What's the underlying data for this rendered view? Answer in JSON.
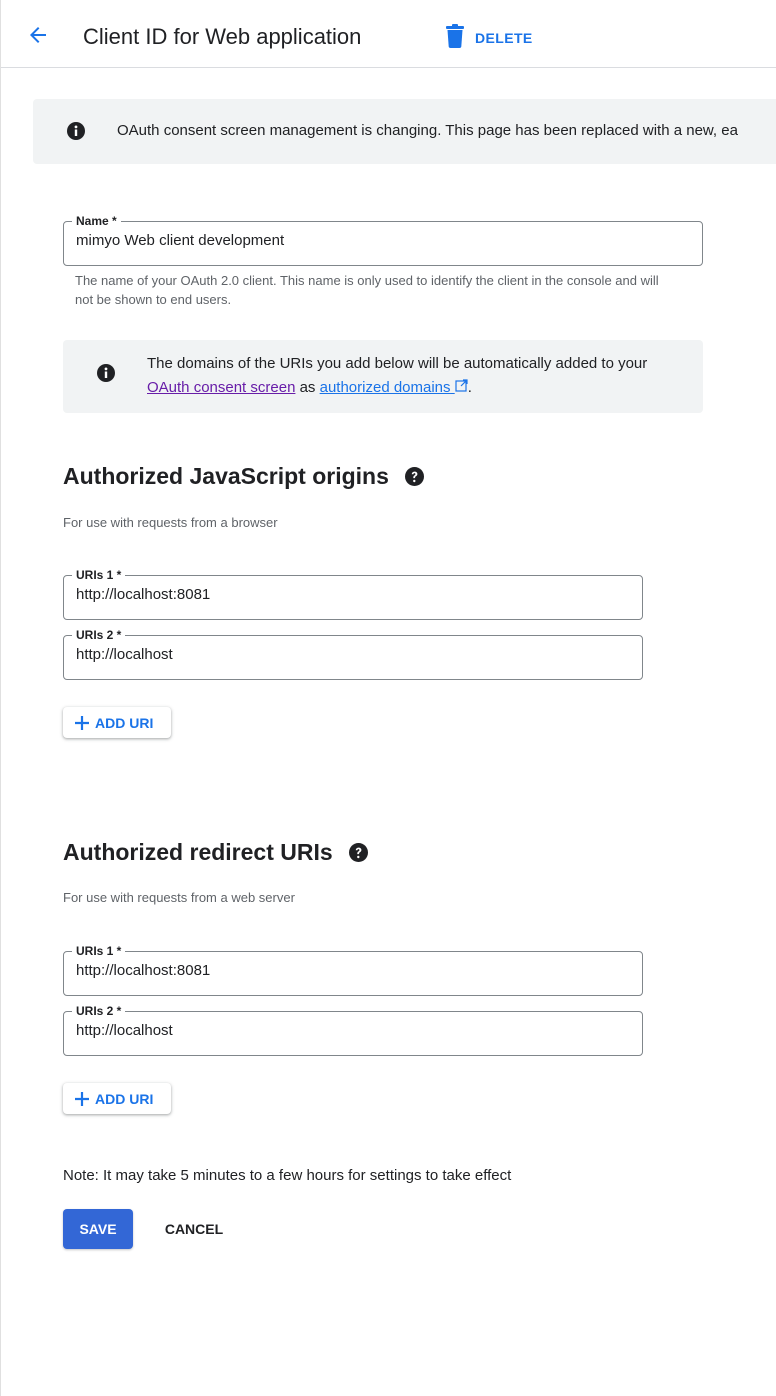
{
  "header": {
    "title": "Client ID for Web application",
    "delete_label": "DELETE"
  },
  "banner": {
    "text": "OAuth consent screen management is changing. This page has been replaced with a new, ea"
  },
  "name_field": {
    "label": "Name *",
    "value": "mimyo Web client development",
    "helper": "The name of your OAuth 2.0 client. This name is only used to identify the client in the console and will not be shown to end users."
  },
  "domain_note": {
    "text_before": "The domains of the URIs you add below will be automatically added to your ",
    "link1": "OAuth consent screen",
    "text_middle": " as ",
    "link2": "authorized domains",
    "text_after": "."
  },
  "js_origins": {
    "title": "Authorized JavaScript origins",
    "subtitle": "For use with requests from a browser",
    "uris": [
      {
        "label": "URIs 1 *",
        "value": "http://localhost:8081"
      },
      {
        "label": "URIs 2 *",
        "value": "http://localhost"
      }
    ],
    "add_label": "ADD URI"
  },
  "redirect_uris": {
    "title": "Authorized redirect URIs",
    "subtitle": "For use with requests from a web server",
    "uris": [
      {
        "label": "URIs 1 *",
        "value": "http://localhost:8081"
      },
      {
        "label": "URIs 2 *",
        "value": "http://localhost"
      }
    ],
    "add_label": "ADD URI"
  },
  "footer": {
    "note": "Note: It may take 5 minutes to a few hours for settings to take effect",
    "save_label": "SAVE",
    "cancel_label": "CANCEL"
  },
  "colors": {
    "accent": "#1a73e8",
    "save_button": "#3367d6",
    "visited_link": "#681da8"
  },
  "icons": [
    "arrow-back-icon",
    "trash-icon",
    "info-icon",
    "help-icon",
    "plus-icon",
    "external-link-icon"
  ]
}
